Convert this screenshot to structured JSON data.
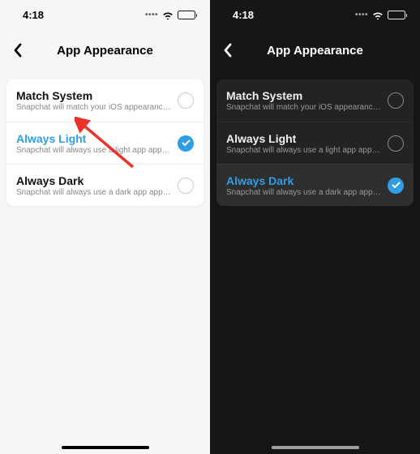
{
  "status": {
    "time": "4:18"
  },
  "nav": {
    "title": "App Appearance"
  },
  "light_panel": {
    "options": [
      {
        "title": "Match System",
        "subtitle": "Snapchat will match your iOS appearance setti…"
      },
      {
        "title": "Always Light",
        "subtitle": "Snapchat will always use a light app appearance."
      },
      {
        "title": "Always Dark",
        "subtitle": "Snapchat will always use a dark app appearance."
      }
    ]
  },
  "dark_panel": {
    "options": [
      {
        "title": "Match System",
        "subtitle": "Snapchat will match your iOS appearance setti…"
      },
      {
        "title": "Always Light",
        "subtitle": "Snapchat will always use a light app appearance."
      },
      {
        "title": "Always Dark",
        "subtitle": "Snapchat will always use a dark app appearance."
      }
    ]
  }
}
